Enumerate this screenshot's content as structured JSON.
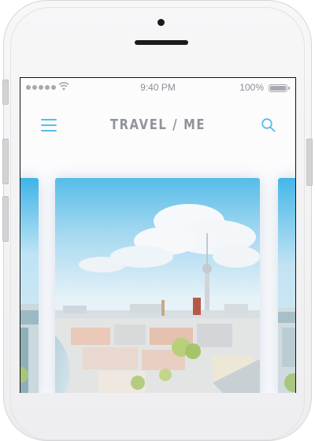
{
  "status_bar": {
    "time": "9:40 PM",
    "battery": "100%"
  },
  "header": {
    "title": "TRAVEL / ME",
    "menu_icon": "hamburger-icon",
    "search_icon": "search-icon"
  },
  "colors": {
    "accent": "#57bde8",
    "title": "#8f939a",
    "status_text": "#8d8f96"
  },
  "carousel": {
    "cards": [
      {
        "position": "previous",
        "image": "city-photo"
      },
      {
        "position": "current",
        "image": "berlin-tv-tower-photo"
      },
      {
        "position": "next",
        "image": "city-photo"
      }
    ]
  }
}
